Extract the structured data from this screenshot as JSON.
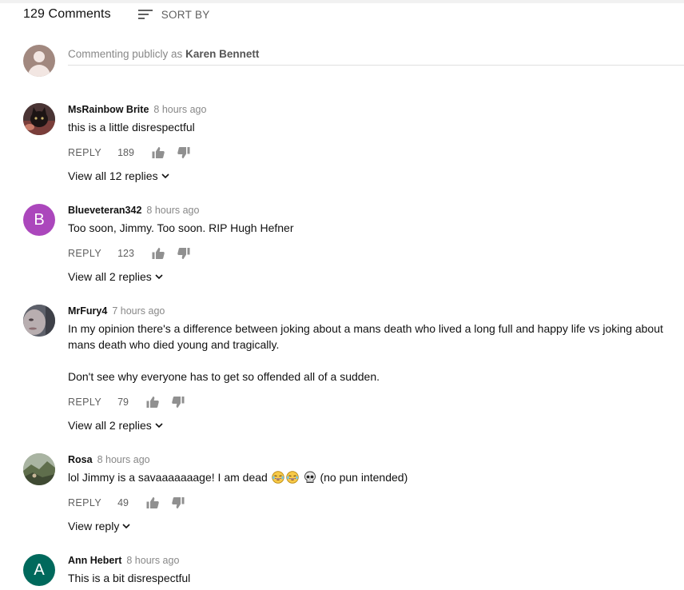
{
  "header": {
    "comment_count": "129 Comments",
    "sort_label": "SORT BY"
  },
  "composer": {
    "prefix": "Commenting publicly as",
    "user": "Karen Bennett"
  },
  "comments": [
    {
      "author": "MsRainbow Brite",
      "time": "8 hours ago",
      "text": "this is a little disrespectful",
      "reply_label": "REPLY",
      "likes": "189",
      "view_replies": "View all 12 replies",
      "avatar_type": "photo-cat"
    },
    {
      "author": "Blueveteran342",
      "time": "8 hours ago",
      "text": "Too soon, Jimmy. Too soon. RIP Hugh Hefner",
      "reply_label": "REPLY",
      "likes": "123",
      "view_replies": "View all 2 replies",
      "avatar_letter": "B",
      "avatar_color": "#ab47bc"
    },
    {
      "author": "MrFury4",
      "time": "7 hours ago",
      "text_line1": "In my opinion there's a difference between joking about a mans death who lived a long full and happy life vs joking about",
      "text_line2": "mans death who died young and tragically.",
      "text_para2": "Don't see why everyone has to get so offended all of a sudden.",
      "reply_label": "REPLY",
      "likes": "79",
      "view_replies": "View all 2 replies",
      "avatar_type": "photo-face"
    },
    {
      "author": "Rosa",
      "time": "8 hours ago",
      "text_before": "lol Jimmy is a savaaaaaaage! I am dead",
      "text_after": "(no pun intended)",
      "emojis": [
        "crying-laughing-emoji",
        "crying-laughing-emoji",
        "skull-emoji"
      ],
      "reply_label": "REPLY",
      "likes": "49",
      "view_replies": "View reply",
      "avatar_type": "photo-landscape"
    },
    {
      "author": "Ann Hebert",
      "time": "8 hours ago",
      "text": "This is a bit disrespectful",
      "avatar_letter": "A",
      "avatar_color": "#00695c"
    }
  ],
  "colors": {
    "meta_gray": "#888888",
    "action_gray": "#606060",
    "text": "#111111"
  }
}
